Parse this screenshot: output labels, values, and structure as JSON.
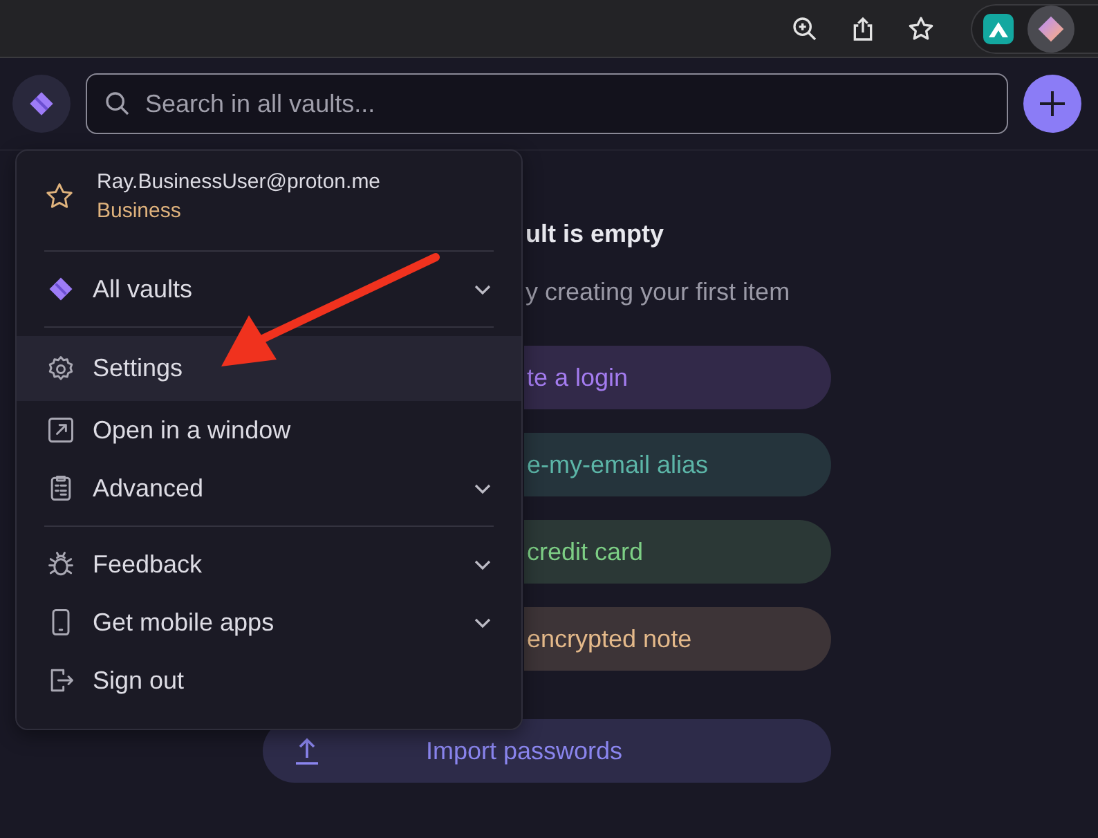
{
  "search": {
    "placeholder": "Search in all vaults..."
  },
  "account": {
    "email": "Ray.BusinessUser@proton.me",
    "plan": "Business"
  },
  "menu_groups": [
    [
      {
        "kind": "vault",
        "label": "All vaults",
        "expandable": true,
        "selected": false
      }
    ],
    [
      {
        "kind": "settings",
        "label": "Settings",
        "expandable": false,
        "selected": true
      },
      {
        "kind": "window",
        "label": "Open in a window",
        "expandable": false,
        "selected": false
      },
      {
        "kind": "advanced",
        "label": "Advanced",
        "expandable": true,
        "selected": false
      }
    ],
    [
      {
        "kind": "feedback",
        "label": "Feedback",
        "expandable": true,
        "selected": false
      },
      {
        "kind": "mobile",
        "label": "Get mobile apps",
        "expandable": true,
        "selected": false
      },
      {
        "kind": "signout",
        "label": "Sign out",
        "expandable": false,
        "selected": false
      }
    ]
  ],
  "empty_state": {
    "title": "ult is empty",
    "subtitle": "y creating your first item",
    "actions": [
      {
        "kind": "plain",
        "label": "te a login",
        "color": "#a47cf0"
      },
      {
        "kind": "plain",
        "label": "e-my-email alias",
        "color": "#5cb6a8"
      },
      {
        "kind": "plain",
        "label": "credit card",
        "color": "#7dcf85"
      },
      {
        "kind": "plain",
        "label": "encrypted note",
        "color": "#e4b98a"
      },
      {
        "kind": "import",
        "label": "Import passwords",
        "color": "#8a85ee"
      }
    ]
  }
}
